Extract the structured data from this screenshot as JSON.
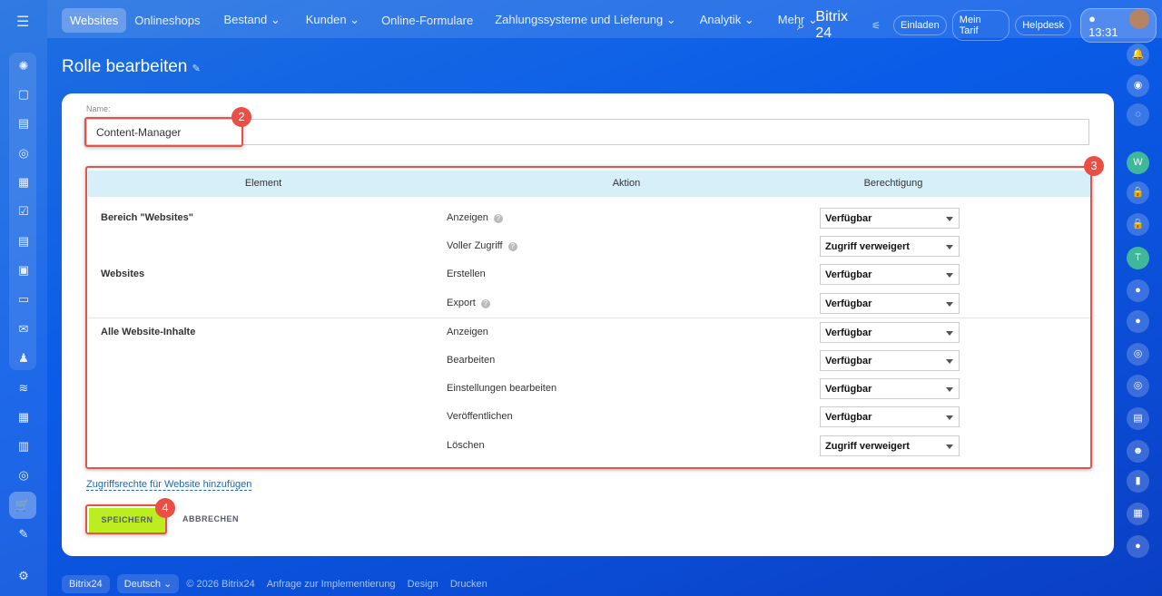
{
  "nav": {
    "items": [
      "Websites",
      "Onlineshops",
      "Bestand ⌄",
      "Kunden ⌄",
      "Online-Formulare",
      "Zahlungssysteme und Lieferung ⌄",
      "Analytik ⌄",
      "Mehr ⌄"
    ]
  },
  "topright": {
    "brand": "Bitrix 24",
    "invite": "Einladen",
    "tariff": "Mein Tarif",
    "helpdesk": "Helpdesk",
    "time": "13:31"
  },
  "page": {
    "title": "Rolle bearbeiten"
  },
  "form": {
    "name_label": "Name:",
    "name_value": "Content-Manager"
  },
  "table": {
    "headers": [
      "Element",
      "Aktion",
      "Berechtigung"
    ],
    "rows": [
      {
        "element": "Bereich \"Websites\"",
        "action": "Anzeigen",
        "help": true,
        "value": "Verfügbar"
      },
      {
        "element": "",
        "action": "Voller Zugriff",
        "help": true,
        "value": "Zugriff verweigert"
      },
      {
        "element": "Websites",
        "action": "Erstellen",
        "help": false,
        "value": "Verfügbar"
      },
      {
        "element": "",
        "action": "Export",
        "help": true,
        "value": "Verfügbar"
      },
      {
        "element": "Alle Website-Inhalte",
        "action": "Anzeigen",
        "help": false,
        "value": "Verfügbar"
      },
      {
        "element": "",
        "action": "Bearbeiten",
        "help": false,
        "value": "Verfügbar"
      },
      {
        "element": "",
        "action": "Einstellungen bearbeiten",
        "help": false,
        "value": "Verfügbar"
      },
      {
        "element": "",
        "action": "Veröffentlichen",
        "help": false,
        "value": "Verfügbar"
      },
      {
        "element": "",
        "action": "Löschen",
        "help": false,
        "value": "Zugriff verweigert"
      }
    ]
  },
  "actions": {
    "add_link": "Zugriffsrechte für Website hinzufügen",
    "save": "SPEICHERN",
    "cancel": "ABBRECHEN"
  },
  "badges": [
    "2",
    "3",
    "4"
  ],
  "footer": {
    "brand": "Bitrix24",
    "language": "Deutsch ⌄",
    "copyright": "© 2026 Bitrix24",
    "links": [
      "Anfrage zur Implementierung",
      "Design",
      "Drucken"
    ]
  },
  "right_avatars": {
    "w": "W",
    "t": "T"
  }
}
